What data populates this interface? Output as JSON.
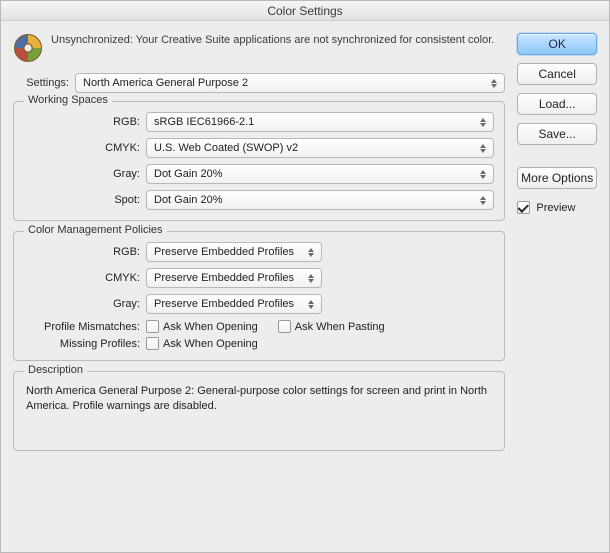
{
  "window": {
    "title": "Color Settings"
  },
  "sync": {
    "message": "Unsynchronized: Your Creative Suite applications are not synchronized for consistent color."
  },
  "settings": {
    "label": "Settings:",
    "value": "North America General Purpose 2"
  },
  "working_spaces": {
    "legend": "Working Spaces",
    "rgb_label": "RGB:",
    "rgb_value": "sRGB IEC61966-2.1",
    "cmyk_label": "CMYK:",
    "cmyk_value": "U.S. Web Coated (SWOP) v2",
    "gray_label": "Gray:",
    "gray_value": "Dot Gain 20%",
    "spot_label": "Spot:",
    "spot_value": "Dot Gain 20%"
  },
  "policies": {
    "legend": "Color Management Policies",
    "rgb_label": "RGB:",
    "rgb_value": "Preserve Embedded Profiles",
    "cmyk_label": "CMYK:",
    "cmyk_value": "Preserve Embedded Profiles",
    "gray_label": "Gray:",
    "gray_value": "Preserve Embedded Profiles",
    "mismatch_label": "Profile Mismatches:",
    "mismatch_open": "Ask When Opening",
    "mismatch_paste": "Ask When Pasting",
    "missing_label": "Missing Profiles:",
    "missing_open": "Ask When Opening"
  },
  "description": {
    "legend": "Description",
    "text": "North America General Purpose 2:  General-purpose color settings for screen and print in North America. Profile warnings are disabled."
  },
  "buttons": {
    "ok": "OK",
    "cancel": "Cancel",
    "load": "Load...",
    "save": "Save...",
    "more": "More Options",
    "preview": "Preview"
  },
  "icons": {
    "sync": "color-wheel-icon"
  }
}
